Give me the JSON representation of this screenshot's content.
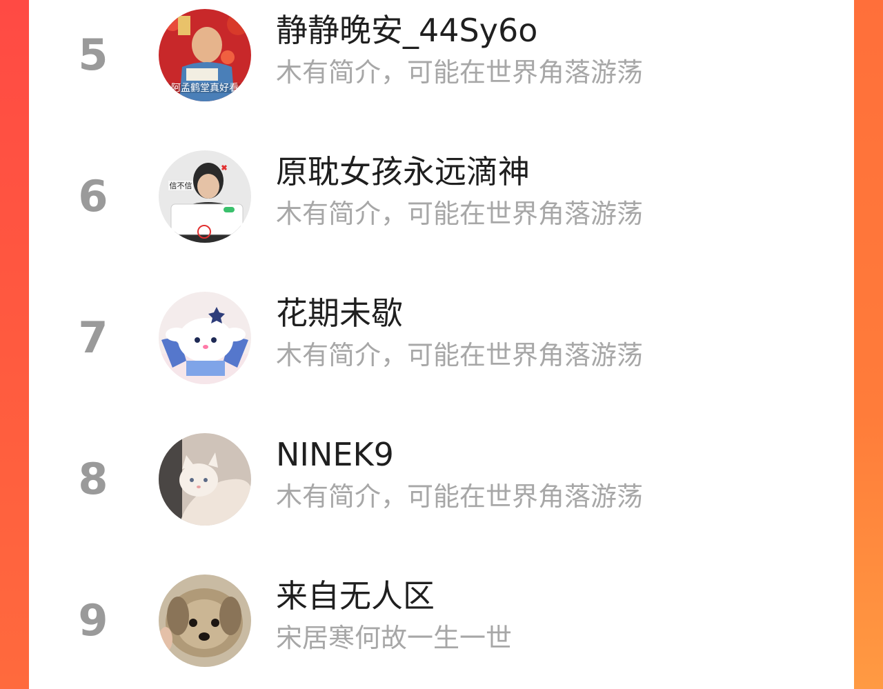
{
  "ranking": {
    "items": [
      {
        "rank": "5",
        "name": "静静晚安_44Sy6o",
        "bio": "木有简介，可能在世界角落游荡",
        "avatar_text": "阿孟鹤堂真好看"
      },
      {
        "rank": "6",
        "name": "原耽女孩永远滴神",
        "bio": "木有简介，可能在世界角落游荡",
        "avatar_text": "信不信"
      },
      {
        "rank": "7",
        "name": "花期未歇",
        "bio": "木有简介，可能在世界角落游荡"
      },
      {
        "rank": "8",
        "name": "NINEK9",
        "bio": "木有简介，可能在世界角落游荡"
      },
      {
        "rank": "9",
        "name": "来自无人区",
        "bio": "宋居寒何故一生一世"
      }
    ]
  },
  "colors": {
    "rank": "#9a9a9a",
    "name": "#1f1f1f",
    "bio": "#a7a7a7",
    "background_gradient_top": "#ff4a3d",
    "background_gradient_bottom": "#ff9a3a"
  }
}
